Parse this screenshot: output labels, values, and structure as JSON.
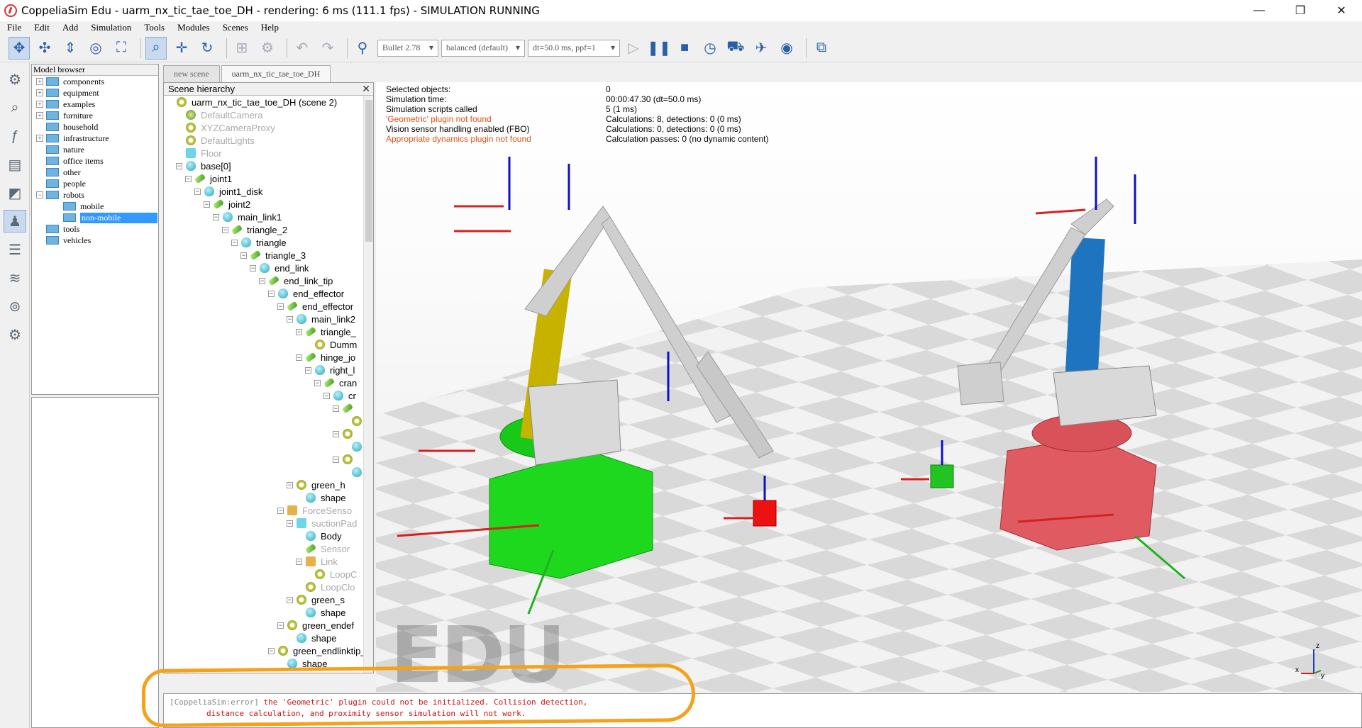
{
  "window": {
    "title": "CoppeliaSim Edu - uarm_nx_tic_tae_toe_DH - rendering: 6 ms (111.1 fps) - SIMULATION RUNNING",
    "minimize": "—",
    "maximize": "❐",
    "close": "✕"
  },
  "menu": [
    "File",
    "Edit",
    "Add",
    "Simulation",
    "Tools",
    "Modules",
    "Scenes",
    "Help"
  ],
  "toolbar": {
    "engine": "Bullet 2.78",
    "accuracy": "balanced (default)",
    "timestep": "dt=50.0 ms, ppf=1"
  },
  "model_browser": {
    "title": "Model browser",
    "items": [
      {
        "label": "components",
        "expander": "+"
      },
      {
        "label": "equipment",
        "expander": "+"
      },
      {
        "label": "examples",
        "expander": "+"
      },
      {
        "label": "furniture",
        "expander": "+"
      },
      {
        "label": "household",
        "expander": ""
      },
      {
        "label": "infrastructure",
        "expander": "+"
      },
      {
        "label": "nature",
        "expander": ""
      },
      {
        "label": "office items",
        "expander": ""
      },
      {
        "label": "other",
        "expander": ""
      },
      {
        "label": "people",
        "expander": ""
      },
      {
        "label": "robots",
        "expander": "−"
      },
      {
        "label": "mobile",
        "expander": "",
        "child": true
      },
      {
        "label": "non-mobile",
        "expander": "",
        "child": true,
        "selected": true
      },
      {
        "label": "tools",
        "expander": ""
      },
      {
        "label": "vehicles",
        "expander": ""
      }
    ]
  },
  "tabs": [
    "new scene",
    "uarm_nx_tic_tae_toe_DH"
  ],
  "scene_hierarchy": {
    "title": "Scene hierarchy",
    "close": "✕",
    "nodes": [
      {
        "label": "uarm_nx_tic_tae_toe_DH (scene 2)",
        "depth": 0,
        "icon": "dummy",
        "ex": ""
      },
      {
        "label": "DefaultCamera",
        "depth": 1,
        "icon": "cam",
        "ex": "",
        "dim": true
      },
      {
        "label": "XYZCameraProxy",
        "depth": 1,
        "icon": "dummy",
        "ex": "",
        "dim": true
      },
      {
        "label": "DefaultLights",
        "depth": 1,
        "icon": "dummy",
        "ex": "",
        "dim": true
      },
      {
        "label": "Floor",
        "depth": 1,
        "icon": "cube",
        "ex": "",
        "dim": true
      },
      {
        "label": "base[0]",
        "depth": 1,
        "icon": "shape",
        "ex": "−"
      },
      {
        "label": "joint1",
        "depth": 2,
        "icon": "joint",
        "ex": "−"
      },
      {
        "label": "joint1_disk",
        "depth": 3,
        "icon": "shape",
        "ex": "−"
      },
      {
        "label": "joint2",
        "depth": 4,
        "icon": "joint",
        "ex": "−"
      },
      {
        "label": "main_link1",
        "depth": 5,
        "icon": "shape",
        "ex": "−"
      },
      {
        "label": "triangle_2",
        "depth": 6,
        "icon": "joint",
        "ex": "−"
      },
      {
        "label": "triangle",
        "depth": 7,
        "icon": "shape",
        "ex": "−"
      },
      {
        "label": "triangle_3",
        "depth": 8,
        "icon": "joint",
        "ex": "−"
      },
      {
        "label": "end_link",
        "depth": 9,
        "icon": "shape",
        "ex": "−"
      },
      {
        "label": "end_link_tip",
        "depth": 10,
        "icon": "joint",
        "ex": "−"
      },
      {
        "label": "end_effector",
        "depth": 11,
        "icon": "shape",
        "ex": "−"
      },
      {
        "label": "end_effector",
        "depth": 12,
        "icon": "joint",
        "ex": "−"
      },
      {
        "label": "main_link2",
        "depth": 13,
        "icon": "shape",
        "ex": "−"
      },
      {
        "label": "triangle_",
        "depth": 14,
        "icon": "joint",
        "ex": "−"
      },
      {
        "label": "Dumm",
        "depth": 15,
        "icon": "dummy",
        "ex": ""
      },
      {
        "label": "hinge_jo",
        "depth": 14,
        "icon": "joint",
        "ex": "−"
      },
      {
        "label": "right_l",
        "depth": 15,
        "icon": "shape",
        "ex": "−"
      },
      {
        "label": "cran",
        "depth": 16,
        "icon": "joint",
        "ex": "−"
      },
      {
        "label": "cr",
        "depth": 17,
        "icon": "shape",
        "ex": "−"
      },
      {
        "label": "",
        "depth": 18,
        "icon": "joint",
        "ex": "−"
      },
      {
        "label": "",
        "depth": 19,
        "icon": "dummy",
        "ex": ""
      },
      {
        "label": "",
        "depth": 18,
        "icon": "dummy",
        "ex": "−"
      },
      {
        "label": "",
        "depth": 19,
        "icon": "shape",
        "ex": ""
      },
      {
        "label": "",
        "depth": 18,
        "icon": "dummy",
        "ex": "−"
      },
      {
        "label": "",
        "depth": 19,
        "icon": "shape",
        "ex": ""
      },
      {
        "label": "green_h",
        "depth": 13,
        "icon": "dummy",
        "ex": "−"
      },
      {
        "label": "shape",
        "depth": 14,
        "icon": "shape",
        "ex": ""
      },
      {
        "label": "ForceSenso",
        "depth": 12,
        "icon": "force",
        "ex": "−",
        "dim": true
      },
      {
        "label": "suctionPad",
        "depth": 13,
        "icon": "cube",
        "ex": "−",
        "dim": true
      },
      {
        "label": "Body",
        "depth": 14,
        "icon": "shape",
        "ex": ""
      },
      {
        "label": "Sensor",
        "depth": 14,
        "icon": "joint",
        "ex": "",
        "dim": true
      },
      {
        "label": "Link",
        "depth": 14,
        "icon": "force",
        "ex": "−",
        "dim": true
      },
      {
        "label": "LoopC",
        "depth": 15,
        "icon": "dummy",
        "ex": "",
        "dim": true
      },
      {
        "label": "LoopClo",
        "depth": 14,
        "icon": "dummy",
        "ex": "",
        "dim": true
      },
      {
        "label": "green_s",
        "depth": 13,
        "icon": "dummy",
        "ex": "−"
      },
      {
        "label": "shape",
        "depth": 14,
        "icon": "shape",
        "ex": ""
      },
      {
        "label": "green_endef",
        "depth": 12,
        "icon": "dummy",
        "ex": "−"
      },
      {
        "label": "shape",
        "depth": 13,
        "icon": "shape",
        "ex": ""
      },
      {
        "label": "green_endlinktip_",
        "depth": 11,
        "icon": "dummy",
        "ex": "−"
      },
      {
        "label": "shape",
        "depth": 12,
        "icon": "shape",
        "ex": ""
      }
    ]
  },
  "viewport": {
    "info": [
      {
        "label": "Selected objects:",
        "value": "0",
        "error": false
      },
      {
        "label": "Simulation time:",
        "value": "00:00:47.30 (dt=50.0 ms)",
        "error": false
      },
      {
        "label": "Simulation scripts called",
        "value": "5 (1 ms)",
        "error": false
      },
      {
        "label": "'Geometric' plugin not found",
        "value": "Calculations: 8, detections: 0 (0 ms)",
        "error": true
      },
      {
        "label": "Vision sensor handling enabled (FBO)",
        "value": "Calculations: 0, detections: 0 (0 ms)",
        "error": false
      },
      {
        "label": "Appropriate dynamics plugin not found",
        "value": "Calculation passes: 0 (no dynamic content)",
        "error": true
      }
    ],
    "watermark": "EDU",
    "axes": {
      "z": "z",
      "x": "x",
      "y": "y"
    }
  },
  "console": {
    "tag": "[CoppeliaSim:error]",
    "line1": "the 'Geometric' plugin could not be initialized. Collision detection,",
    "line2": "distance calculation, and proximity sensor simulation will not work."
  }
}
